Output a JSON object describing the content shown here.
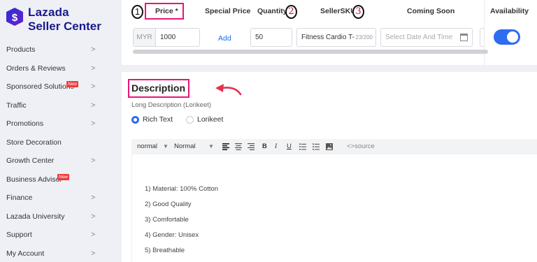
{
  "brand": {
    "name": "Lazada",
    "product": "Seller Center",
    "color": "#1a1a8c"
  },
  "sidebar": {
    "items": [
      {
        "label": "Products",
        "chevron": true,
        "badge": ""
      },
      {
        "label": "Orders & Reviews",
        "chevron": true,
        "badge": ""
      },
      {
        "label": "Sponsored Solutions",
        "chevron": true,
        "badge": "New"
      },
      {
        "label": "Traffic",
        "chevron": true,
        "badge": ""
      },
      {
        "label": "Promotions",
        "chevron": true,
        "badge": ""
      },
      {
        "label": "Store Decoration",
        "chevron": false,
        "badge": ""
      },
      {
        "label": "Growth Center",
        "chevron": true,
        "badge": ""
      },
      {
        "label": "Business Advisor",
        "chevron": false,
        "badge": "New"
      },
      {
        "label": "Finance",
        "chevron": true,
        "badge": ""
      },
      {
        "label": "Lazada University",
        "chevron": true,
        "badge": ""
      },
      {
        "label": "Support",
        "chevron": true,
        "badge": ""
      },
      {
        "label": "My Account",
        "chevron": true,
        "badge": ""
      }
    ],
    "chevron_glyph": ">"
  },
  "variant_table": {
    "headers": {
      "price": "Price *",
      "special_price": "Special Price",
      "quantity": "Quantity",
      "seller_sku": "SellerSKU",
      "coming_soon": "Coming Soon",
      "availability": "Availability"
    },
    "annotations": {
      "one": "1",
      "two": "2",
      "three": "3"
    },
    "row": {
      "currency": "MYR",
      "price": "1000",
      "special_price_action": "Add",
      "quantity": "50",
      "seller_sku": "Fitness Cardio T-",
      "seller_sku_count": "23/200",
      "coming_soon_placeholder": "Select Date And Time",
      "available": true
    }
  },
  "description": {
    "title": "Description",
    "subtitle": "Long Description (Lorikeet)",
    "editor_options": [
      {
        "label": "Rich Text",
        "selected": true
      },
      {
        "label": "Lorikeet",
        "selected": false
      }
    ],
    "toolbar": {
      "format": "normal",
      "size": "Normal",
      "source_label": "<>source",
      "icons": [
        "align-left-icon",
        "align-center-icon",
        "align-right-icon",
        "bold-icon",
        "italic-icon",
        "underline-icon",
        "ordered-list-icon",
        "bullet-list-icon",
        "image-icon"
      ]
    },
    "content_lines": [
      "1) Material: 100% Cotton",
      "2) Good Quality",
      "3) Comfortable",
      "4) Gender: Unisex",
      "5) Breathable"
    ]
  },
  "colors": {
    "accent": "#2e6cf0",
    "highlight": "#e8157a",
    "arrow": "#e0334f",
    "new_badge": "#f03a3a"
  }
}
